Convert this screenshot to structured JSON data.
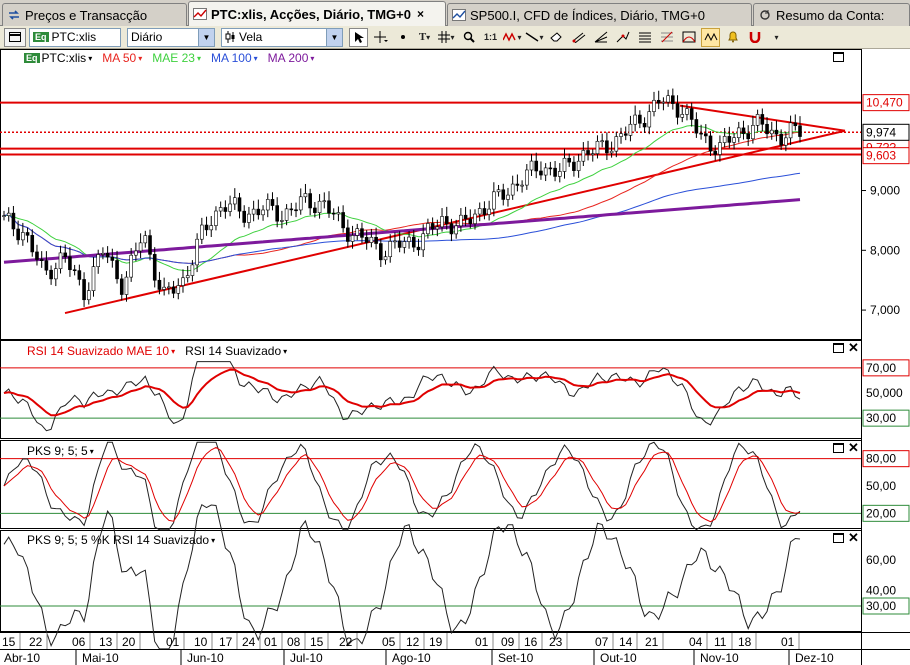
{
  "tabs": [
    {
      "label": "Preços e Transacção",
      "active": false
    },
    {
      "label": "PTC:xlis, Acções, Diário, TMG+0",
      "active": true,
      "close": "×"
    },
    {
      "label": "SP500.I, CFD de Índices, Diário, TMG+0",
      "active": false
    },
    {
      "label": "Resumo da Conta:",
      "active": false
    }
  ],
  "toolbar": {
    "symbol": "PTC:xlis",
    "symbol_badge": "Eq",
    "period": "Diário",
    "chart_style": "Vela",
    "ratio_label": "1:1"
  },
  "main_legend": {
    "badge": "Eq",
    "symbol": "PTC:xlis",
    "ma1": "MA 50",
    "ma2": "MAE 23",
    "ma3": "MA 100",
    "ma4": "MA 200",
    "colors": {
      "ma1": "#e8251f",
      "ma2": "#3fd13f",
      "ma3": "#2a4fd8",
      "ma4": "#7d1a9c"
    }
  },
  "price_axis": {
    "labels": [
      "9,000",
      "8,000",
      "7,000"
    ],
    "levels": [
      {
        "value": "10,470",
        "color": "#e00000"
      },
      {
        "value": "9,974",
        "color": "#000000"
      },
      {
        "value": "9,603",
        "color": "#e00000"
      },
      {
        "value": "9,7??",
        "color": "#e00000"
      }
    ]
  },
  "rsi_pane": {
    "legend1": "RSI 14 Suavizado MAE 10",
    "legend2": "RSI 14 Suavizado",
    "labels": [
      "70,00",
      "50,000",
      "30,00"
    ]
  },
  "pks_pane": {
    "legend": "PKS 9; 5; 5",
    "labels": [
      "80,00",
      "50,00",
      "20,00"
    ]
  },
  "pks_rsi_pane": {
    "legend": "PKS 9; 5; 5 %K RSI 14 Suavizado",
    "labels": [
      "60,00",
      "40,00",
      "30,00"
    ]
  },
  "time_axis": {
    "days": [
      "15",
      "22",
      "06",
      "13",
      "20",
      "01",
      "10",
      "17",
      "24",
      "01",
      "08",
      "15",
      "22",
      "05",
      "12",
      "19",
      "01",
      "09",
      "16",
      "23",
      "07",
      "14",
      "21",
      "04",
      "11",
      "18",
      "01"
    ],
    "months": [
      "Abr-10",
      "Mai-10",
      "Jun-10",
      "Jul-10",
      "Ago-10",
      "Set-10",
      "Out-10",
      "Nov-10",
      "Dez-10"
    ]
  },
  "chart_data": {
    "type": "candlestick",
    "symbol": "PTC:xlis",
    "period": "Diário",
    "price_range": [
      6.6,
      11.2
    ],
    "horizontal_levels": [
      10.47,
      9.974,
      9.7,
      9.603
    ],
    "close_approx": [
      8.5,
      8.3,
      7.6,
      7.9,
      7.3,
      8.0,
      7.4,
      8.3,
      7.2,
      7.5,
      8.3,
      8.8,
      8.6,
      8.7,
      8.6,
      8.8,
      8.8,
      8.4,
      8.2,
      8.0,
      8.1,
      8.2,
      8.5,
      8.4,
      8.7,
      8.9,
      9.2,
      9.4,
      9.3,
      9.6,
      9.7,
      9.9,
      10.2,
      10.5,
      10.4,
      9.9,
      9.7,
      10.0,
      10.1,
      9.9,
      10.0
    ]
  }
}
